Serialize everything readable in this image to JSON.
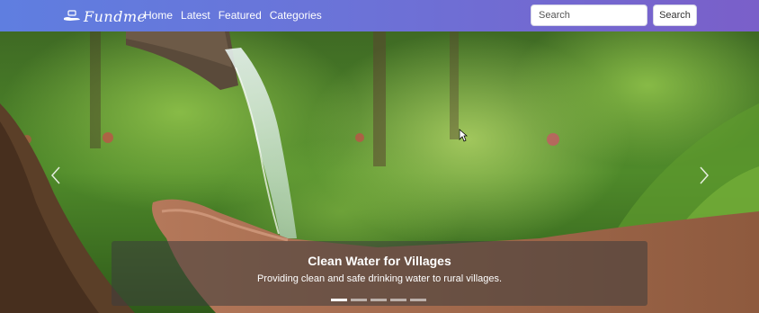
{
  "brand": {
    "name": "Fundme",
    "logo_icon": "hand-coin-icon"
  },
  "nav": {
    "links": [
      "Home",
      "Latest",
      "Featured",
      "Categories"
    ]
  },
  "search": {
    "placeholder": "Search",
    "button_label": "Search"
  },
  "carousel": {
    "slide_count": 5,
    "active_index": 0,
    "caption_title": "Clean Water for Villages",
    "caption_text": "Providing clean and safe drinking water to rural villages.",
    "prev_icon": "chevron-left-icon",
    "next_icon": "chevron-right-icon"
  },
  "colors": {
    "navbar_start": "#5f7ee0",
    "navbar_end": "#7a5fc9",
    "accent": "#ffffff"
  }
}
